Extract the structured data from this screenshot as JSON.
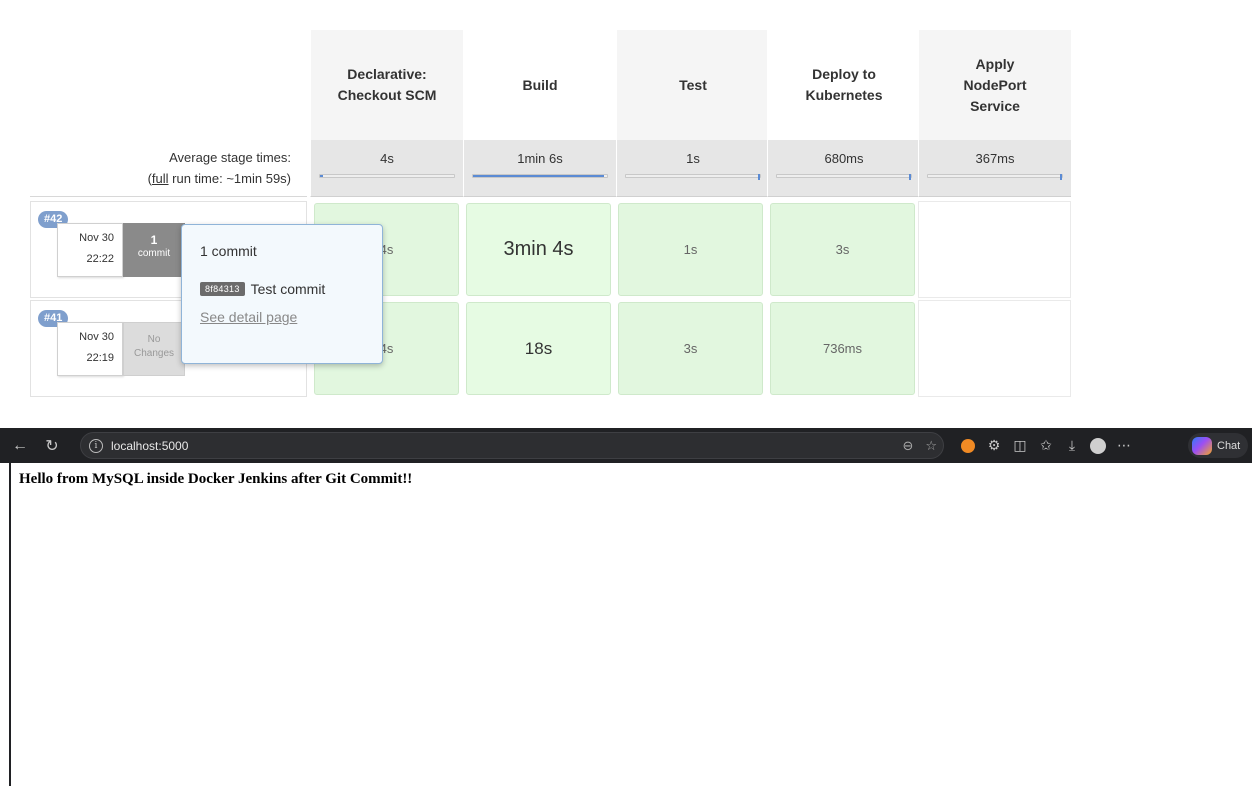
{
  "stage_view": {
    "stages": [
      {
        "name": "Declarative: Checkout SCM",
        "avg": "4s",
        "avg_fraction": 0.04
      },
      {
        "name": "Build",
        "avg": "1min 6s",
        "avg_fraction": 0.98
      },
      {
        "name": "Test",
        "avg": "1s",
        "avg_fraction": 0.01
      },
      {
        "name": "Deploy to Kubernetes",
        "avg": "680ms",
        "avg_fraction": 0.01
      },
      {
        "name": "Apply NodePort Service",
        "avg": "367ms",
        "avg_fraction": 0.01
      }
    ],
    "avg_label": "Average stage times:",
    "full_run_prefix": "(",
    "full_link": "full",
    "full_run_suffix": " run time: ~1min 59s)",
    "runs": [
      {
        "badge": "#42",
        "date": "Nov 30",
        "time": "22:22",
        "changes_count": "1",
        "changes_label": "commit",
        "times": [
          "4s",
          "3min 4s",
          "1s",
          "3s",
          ""
        ]
      },
      {
        "badge": "#41",
        "date": "Nov 30",
        "time": "22:19",
        "changes_count": "No",
        "changes_label": "Changes",
        "times": [
          "4s",
          "18s",
          "3s",
          "736ms",
          ""
        ]
      }
    ],
    "popup": {
      "title": "1 commit",
      "hash": "8f84313",
      "message": "Test commit",
      "link": "See detail page"
    }
  },
  "browser": {
    "url": "localhost:5000",
    "chat_label": "Chat",
    "page_text": "Hello from MySQL inside Docker Jenkins after Git Commit!!"
  },
  "icons": [
    "back-icon",
    "refresh-icon",
    "info-icon",
    "zoom-icon",
    "star-icon",
    "extension-icon",
    "split-screen-icon",
    "favorites-icon",
    "download-icon",
    "profile-icon",
    "more-icon",
    "copilot-icon"
  ]
}
